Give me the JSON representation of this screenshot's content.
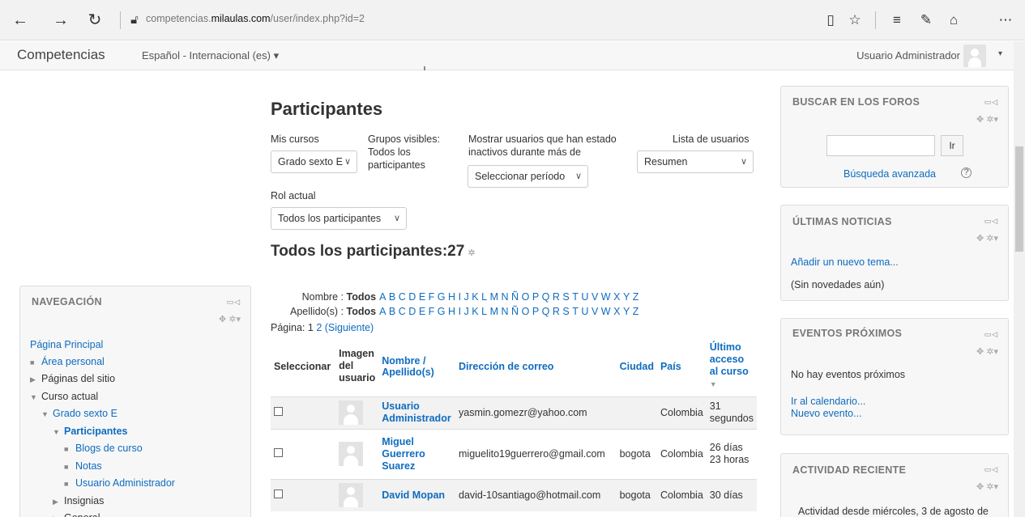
{
  "browser": {
    "back": "←",
    "forward": "→",
    "refresh": "↻",
    "url_prefix": "competencias.",
    "url_domain": "milaulas.com",
    "url_path": "/user/index.php?id=2"
  },
  "topbar": {
    "brand": "Competencias",
    "language": "Español - Internacional (es) ▾",
    "user": "Usuario Administrador",
    "caret": "▾"
  },
  "main": {
    "title": "Participantes",
    "filters": {
      "mis_cursos_label": "Mis cursos",
      "mis_cursos_value": "Grado sexto E",
      "grupos_label": "Grupos visibles:",
      "grupos_value_1": "Todos los",
      "grupos_value_2": "participantes",
      "inactivos_label_1": "Mostrar usuarios que han estado",
      "inactivos_label_2": "inactivos durante más de",
      "inactivos_value": "Seleccionar período",
      "lista_label": "Lista de usuarios",
      "lista_value": "Resumen",
      "rol_label": "Rol actual",
      "rol_value": "Todos los participantes"
    },
    "section_title": "Todos los participantes:27",
    "nombre_label": "Nombre :",
    "apellido_label": "Apellido(s) :",
    "todos": "Todos",
    "letters": [
      "A",
      "B",
      "C",
      "D",
      "E",
      "F",
      "G",
      "H",
      "I",
      "J",
      "K",
      "L",
      "M",
      "N",
      "Ñ",
      "O",
      "P",
      "Q",
      "R",
      "S",
      "T",
      "U",
      "V",
      "W",
      "X",
      "Y",
      "Z"
    ],
    "pagina_label": "Página: 1",
    "page_2": "2",
    "siguiente": "(Siguiente)",
    "table": {
      "headers": {
        "select": "Seleccionar",
        "image": "Imagen del usuario",
        "name": "Nombre / Apellido(s)",
        "email": "Dirección de correo",
        "city": "Ciudad",
        "country": "País",
        "lastaccess": "Último acceso al curso"
      },
      "rows": [
        {
          "name": "Usuario Administrador",
          "email": "yasmin.gomezr@yahoo.com",
          "city": "",
          "country": "Colombia",
          "last": "31 segundos"
        },
        {
          "name": "Miguel Guerrero Suarez",
          "email": "miguelito19guerrero@gmail.com",
          "city": "bogota",
          "country": "Colombia",
          "last": "26 días 23 horas"
        },
        {
          "name": "David Mopan",
          "email": "david-10santiago@hotmail.com",
          "city": "bogota",
          "country": "Colombia",
          "last": "30 días"
        }
      ]
    }
  },
  "navigation": {
    "title": "NAVEGACIÓN",
    "items": [
      {
        "label": "Página Principal",
        "marker": ""
      },
      {
        "label": "Área personal",
        "marker": "■"
      },
      {
        "label": "Páginas del sitio",
        "marker": "▶"
      },
      {
        "label": "Curso actual",
        "marker": "▼"
      },
      {
        "label": "Grado sexto E",
        "marker": "▼"
      },
      {
        "label": "Participantes",
        "marker": "▼"
      },
      {
        "label": "Blogs de curso",
        "marker": "■"
      },
      {
        "label": "Notas",
        "marker": "■"
      },
      {
        "label": "Usuario Administrador",
        "marker": "■"
      },
      {
        "label": "Insignias",
        "marker": "▶"
      },
      {
        "label": "General",
        "marker": "▶"
      }
    ]
  },
  "blocks": {
    "buscar": {
      "title": "BUSCAR EN LOS FOROS",
      "button": "Ir",
      "advanced": "Búsqueda avanzada"
    },
    "noticias": {
      "title": "ÚLTIMAS NOTICIAS",
      "add": "Añadir un nuevo tema...",
      "empty": "(Sin novedades aún)"
    },
    "eventos": {
      "title": "EVENTOS PRÓXIMOS",
      "empty": "No hay eventos próximos",
      "calendar": "Ir al calendario...",
      "new": "Nuevo evento..."
    },
    "actividad": {
      "title": "ACTIVIDAD RECIENTE",
      "since": "Actividad desde miércoles, 3 de agosto de"
    }
  }
}
